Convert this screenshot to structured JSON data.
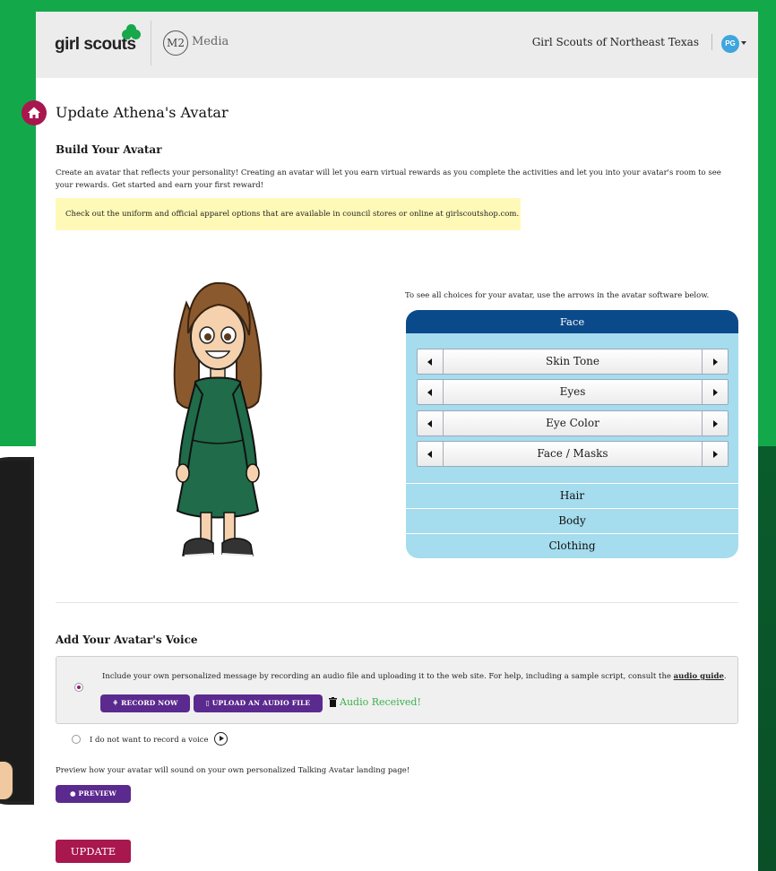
{
  "header": {
    "brand_logo_text": "girl scouts",
    "partner_badge": "M2",
    "partner_name": "Media",
    "council_name": "Girl Scouts of Northeast Texas",
    "user_initials": "PG"
  },
  "page": {
    "title": "Update Athena's Avatar"
  },
  "build": {
    "heading": "Build Your Avatar",
    "description": "Create an avatar that reflects your personality!  Creating an avatar will let you earn virtual rewards as you complete the activities and let you into your avatar's room to see your rewards. Get started and earn your first reward!",
    "notice": "Check out the uniform and official apparel options that are available in council stores or online at girlscoutshop.com."
  },
  "editor": {
    "hint": "To see all choices for your avatar, use the arrows in the avatar software below.",
    "active_section": "Face",
    "face_options": [
      "Skin Tone",
      "Eyes",
      "Eye Color",
      "Face / Masks"
    ],
    "other_sections": [
      "Hair",
      "Body",
      "Clothing"
    ]
  },
  "voice": {
    "heading": "Add Your Avatar's Voice",
    "record_description": "Include your own personalized message by recording an audio file and uploading it to the web site. For help, including a sample script, consult the",
    "audio_guide_link": "audio guide",
    "record_button": "RECORD NOW",
    "upload_button": "UPLOAD AN AUDIO FILE",
    "audio_status": "Audio Received!",
    "no_voice_label": "I do not want to record a voice",
    "preview_hint": "Preview how your avatar will sound on your own personalized Talking Avatar landing page!",
    "preview_button": "PREVIEW"
  },
  "actions": {
    "update_button": "UPDATE"
  },
  "colors": {
    "brand_green": "#13a84a",
    "magenta": "#a8174e",
    "purple": "#5b2a8e",
    "navy": "#0b4a8a",
    "panel_blue": "#a5dcee",
    "notice_yellow": "#fff9b8",
    "success_green": "#3bb04a"
  }
}
